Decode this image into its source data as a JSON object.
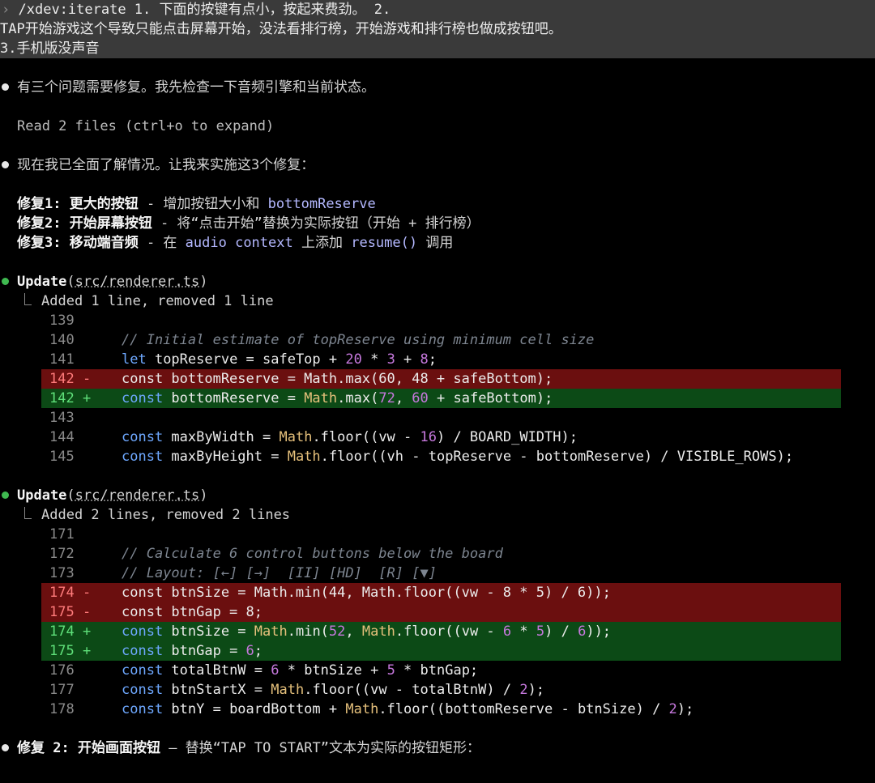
{
  "prompt": {
    "lines": [
      "/xdev:iterate 1. 下面的按键有点小，按起来费劲。 2.",
      "TAP开始游戏这个导致只能点击屏幕开始，没法看排行榜，开始游戏和排行榜也做成按钮吧。",
      "3.手机版没声音"
    ]
  },
  "messages": {
    "m1": "有三个问题需要修复。我先检查一下音频引擎和当前状态。",
    "read_files": "Read 2 files (ctrl+o to expand)",
    "m2": "现在我已全面了解情况。让我来实施这3个修复：",
    "fixes": [
      {
        "title": "修复1: 更大的按钮",
        "desc1": " - 增加按钮大小和 ",
        "hl1": "bottomReserve",
        "desc2": "",
        "hl2": "",
        "desc3": ""
      },
      {
        "title": "修复2: 开始屏幕按钮",
        "desc1": " - 将“点击开始”替换为实际按钮（开始 + 排行榜）",
        "hl1": "",
        "desc2": "",
        "hl2": "",
        "desc3": ""
      },
      {
        "title": "修复3: 移动端音频",
        "desc1": " - 在 ",
        "hl1": "audio context",
        "desc2": " 上添加 ",
        "hl2": "resume()",
        "desc3": " 调用"
      }
    ],
    "m3_title": "修复 2: 开始画面按钮",
    "m3_desc": " — 替换“TAP TO START”文本为实际的按钮矩形："
  },
  "updates": [
    {
      "tool": "Update",
      "path": "src/renderer.ts",
      "summary": "Added 1 line, removed 1 line",
      "rows": [
        {
          "ln": "139",
          "mark": "",
          "type": "ctx"
        },
        {
          "ln": "140",
          "mark": "",
          "type": "ctx"
        },
        {
          "ln": "141",
          "mark": "",
          "type": "ctx"
        },
        {
          "ln": "142",
          "mark": "-",
          "type": "del"
        },
        {
          "ln": "142",
          "mark": "+",
          "type": "add"
        },
        {
          "ln": "143",
          "mark": "",
          "type": "ctx"
        },
        {
          "ln": "144",
          "mark": "",
          "type": "ctx"
        },
        {
          "ln": "145",
          "mark": "",
          "type": "ctx"
        }
      ]
    },
    {
      "tool": "Update",
      "path": "src/renderer.ts",
      "summary": "Added 2 lines, removed 2 lines",
      "rows": [
        {
          "ln": "171",
          "mark": "",
          "type": "ctx"
        },
        {
          "ln": "172",
          "mark": "",
          "type": "ctx"
        },
        {
          "ln": "173",
          "mark": "",
          "type": "ctx"
        },
        {
          "ln": "174",
          "mark": "-",
          "type": "del"
        },
        {
          "ln": "175",
          "mark": "-",
          "type": "del"
        },
        {
          "ln": "174",
          "mark": "+",
          "type": "add"
        },
        {
          "ln": "175",
          "mark": "+",
          "type": "add"
        },
        {
          "ln": "176",
          "mark": "",
          "type": "ctx"
        },
        {
          "ln": "177",
          "mark": "",
          "type": "ctx"
        },
        {
          "ln": "178",
          "mark": "",
          "type": "ctx"
        }
      ]
    }
  ],
  "code": {
    "u1_139": {
      "c": ""
    },
    "u1_140": {
      "c": "// Initial estimate of topReserve using minimum cell size"
    },
    "u1_141": {
      "k": "let",
      "a": " topReserve = safeTop + ",
      "n1": "20",
      "b": " * ",
      "n2": "3",
      "c": " + ",
      "n3": "8",
      "d": ";"
    },
    "u1_142d": {
      "t": "const bottomReserve = Math.max(60, 48 + safeBottom);"
    },
    "u1_142a": {
      "k": "const",
      "a": " bottomReserve = ",
      "f": "Math",
      "b": ".max(",
      "n1": "72",
      "c": ", ",
      "n2": "60",
      "d": " + safeBottom);"
    },
    "u1_143": {
      "c": ""
    },
    "u1_144": {
      "k": "const",
      "a": " maxByWidth = ",
      "f": "Math",
      "b": ".floor((vw - ",
      "n1": "16",
      "c": ") / BOARD_WIDTH);"
    },
    "u1_145": {
      "k": "const",
      "a": " maxByHeight = ",
      "f": "Math",
      "b": ".floor((vh - topReserve - bottomReserve) / VISIBLE_ROWS);"
    },
    "u2_171": {
      "c": ""
    },
    "u2_172": {
      "c": "// Calculate 6 control buttons below the board"
    },
    "u2_173": {
      "c": "// Layout: [←] [→]  [II] [HD]  [R] [▼]"
    },
    "u2_174d": {
      "t": "const btnSize = Math.min(44, Math.floor((vw - 8 * 5) / 6));"
    },
    "u2_175d": {
      "t": "const btnGap = 8;"
    },
    "u2_174a": {
      "k": "const",
      "a": " btnSize = ",
      "f": "Math",
      "b": ".min(",
      "n1": "52",
      "c": ", ",
      "f2": "Math",
      "d": ".floor((vw - ",
      "n2": "6",
      "e": " * ",
      "n3": "5",
      "g": ") / ",
      "n4": "6",
      "h": "));"
    },
    "u2_175a": {
      "k": "const",
      "a": " btnGap = ",
      "n1": "6",
      "b": ";"
    },
    "u2_176": {
      "k": "const",
      "a": " totalBtnW = ",
      "n1": "6",
      "b": " * btnSize + ",
      "n2": "5",
      "c": " * btnGap;"
    },
    "u2_177": {
      "k": "const",
      "a": " btnStartX = ",
      "f": "Math",
      "b": ".floor((vw - totalBtnW) / ",
      "n1": "2",
      "c": ");"
    },
    "u2_178": {
      "k": "const",
      "a": " btnY = boardBottom + ",
      "f": "Math",
      "b": ".floor((bottomReserve - btnSize) / ",
      "n1": "2",
      "c": ");"
    }
  }
}
